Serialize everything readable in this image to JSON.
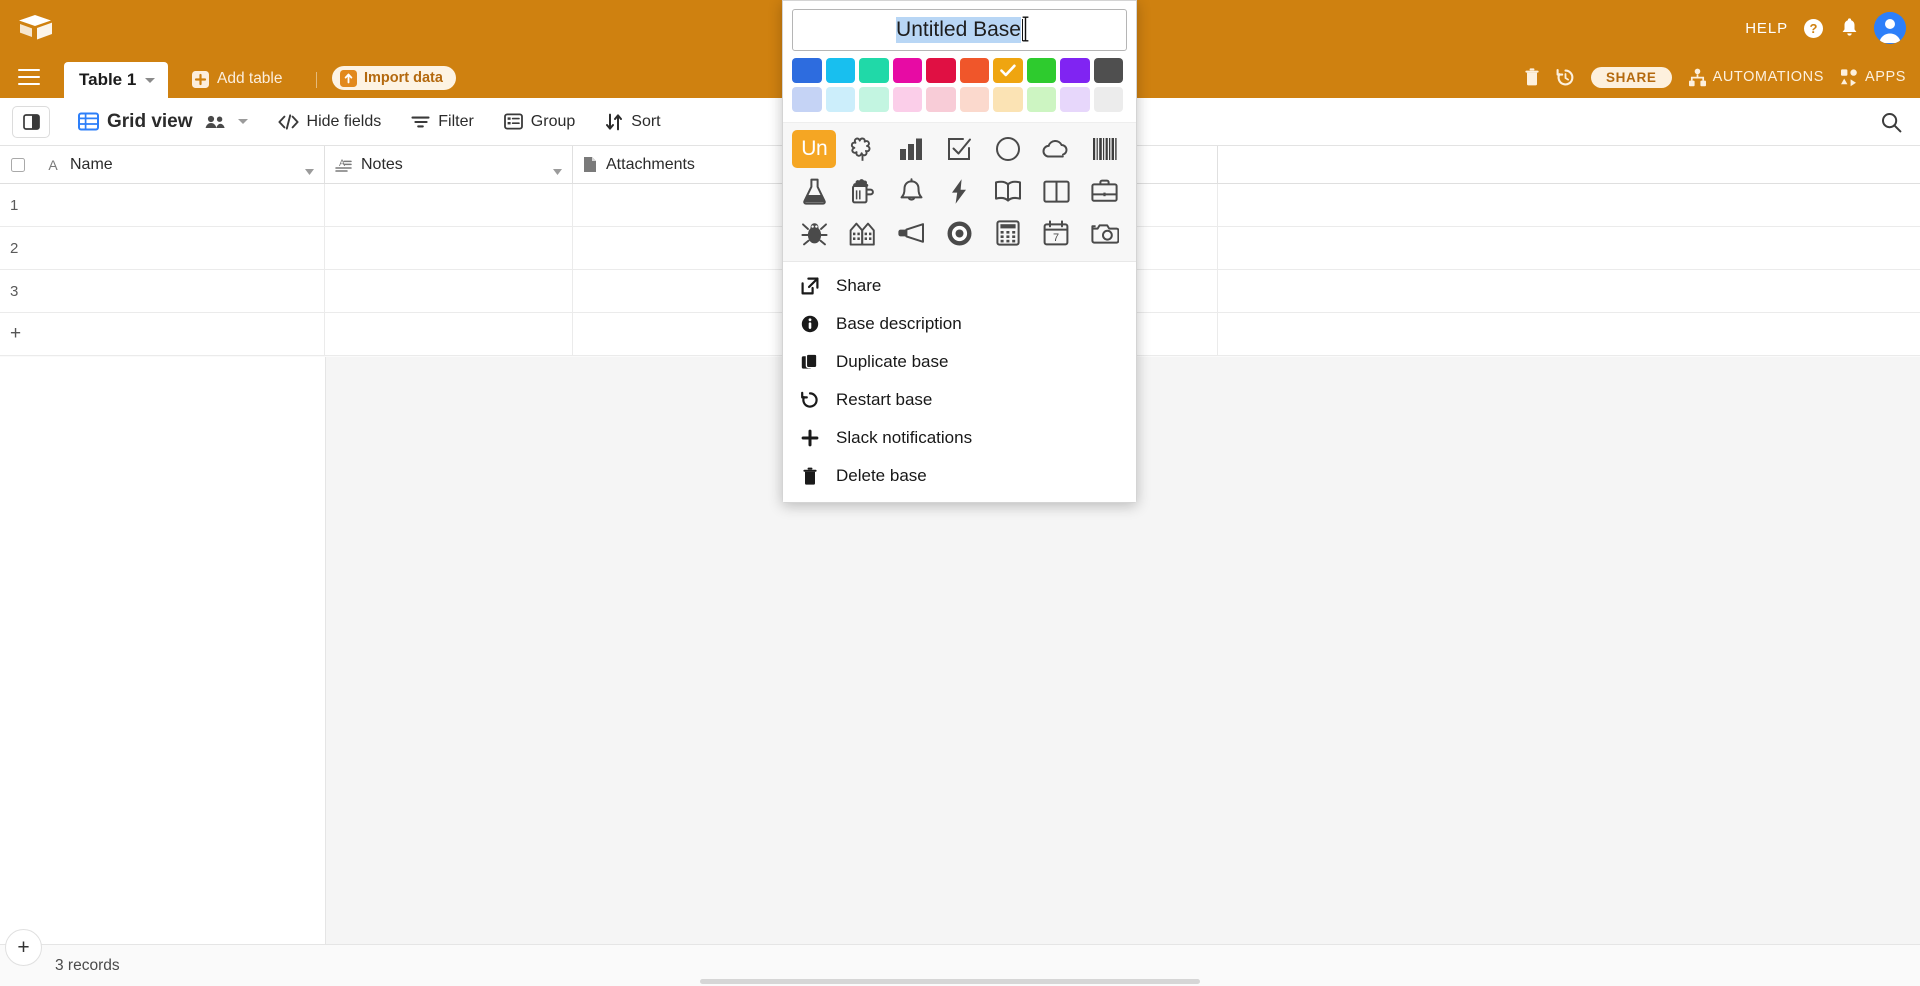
{
  "brand": {
    "logo_icon": "airtable-cube-logo",
    "header_bg": "#cf8110",
    "accent": "#2d7ff9"
  },
  "topbar": {
    "help_label": "HELP",
    "help_icon": "question-circle-icon",
    "notifications_icon": "bell-icon",
    "avatar_icon": "user-avatar-icon"
  },
  "tabbar": {
    "menu_icon": "hamburger-menu-icon",
    "active_tab": "Table 1",
    "tab_caret_icon": "chevron-down-icon",
    "add_table_label": "Add table",
    "add_table_icon": "plus-square-icon",
    "import_label": "Import data",
    "import_icon": "upload-arrow-icon",
    "tools": {
      "trash_icon": "trash-icon",
      "history_icon": "clock-history-icon",
      "share_label": "SHARE",
      "automations_label": "AUTOMATIONS",
      "automations_icon": "automations-node-icon",
      "apps_label": "APPS",
      "apps_icon": "apps-blocks-icon"
    }
  },
  "viewbar": {
    "sidebar_toggle_icon": "sidebar-panel-icon",
    "grid_view_label": "Grid view",
    "grid_view_icon": "grid-table-icon",
    "collaborators_icon": "people-group-icon",
    "view_caret_icon": "chevron-down-icon",
    "items": [
      {
        "label": "Hide fields",
        "icon": "hide-fields-icon"
      },
      {
        "label": "Filter",
        "icon": "filter-icon"
      },
      {
        "label": "Group",
        "icon": "group-icon"
      },
      {
        "label": "Sort",
        "icon": "sort-arrows-icon"
      }
    ],
    "search_icon": "search-icon"
  },
  "grid": {
    "select_all_icon": "checkbox-icon",
    "columns": [
      {
        "name": "Name",
        "type_icon": "text-A-icon"
      },
      {
        "name": "Notes",
        "type_icon": "long-text-icon"
      },
      {
        "name": "Attachments",
        "type_icon": "attachment-file-icon"
      }
    ],
    "rows": [
      {
        "num": "1",
        "Name": "",
        "Notes": "",
        "Attachments": ""
      },
      {
        "num": "2",
        "Name": "",
        "Notes": "",
        "Attachments": ""
      },
      {
        "num": "3",
        "Name": "",
        "Notes": "",
        "Attachments": ""
      }
    ],
    "add_row_icon": "plus-icon"
  },
  "footer": {
    "add_record_icon": "plus-icon",
    "record_count": "3 records"
  },
  "popup": {
    "title_value": "Untitled Base",
    "title_selected": true,
    "cursor_icon": "text-ibeam-cursor",
    "colors_row1": [
      {
        "name": "blue",
        "hex": "#2d6cdf"
      },
      {
        "name": "cyan",
        "hex": "#18bfef"
      },
      {
        "name": "teal",
        "hex": "#20d9a8"
      },
      {
        "name": "magenta",
        "hex": "#e70ba4"
      },
      {
        "name": "crimson",
        "hex": "#e01043"
      },
      {
        "name": "orangered",
        "hex": "#f0562a"
      },
      {
        "name": "amber",
        "hex": "#efa510"
      },
      {
        "name": "green",
        "hex": "#2ecb2e"
      },
      {
        "name": "purple",
        "hex": "#8024f2"
      },
      {
        "name": "gray",
        "hex": "#4f4f4f"
      }
    ],
    "colors_row2": [
      {
        "name": "blue-light",
        "hex": "#c5d3f5"
      },
      {
        "name": "cyan-light",
        "hex": "#cceefb"
      },
      {
        "name": "teal-light",
        "hex": "#c3f5e1"
      },
      {
        "name": "magenta-light",
        "hex": "#fbcee9"
      },
      {
        "name": "crimson-light",
        "hex": "#f8ccd7"
      },
      {
        "name": "orangered-light",
        "hex": "#fbd9cd"
      },
      {
        "name": "amber-light",
        "hex": "#fbe3b4"
      },
      {
        "name": "green-light",
        "hex": "#cdf5c2"
      },
      {
        "name": "purple-light",
        "hex": "#e7d7fb"
      },
      {
        "name": "gray-light",
        "hex": "#ececec"
      }
    ],
    "selected_color": "amber",
    "selected_color_check_icon": "check-icon",
    "icons": [
      "Un",
      "asterisk-flower-icon",
      "bar-chart-icon",
      "checkbox-check-icon",
      "circle-icon",
      "cloud-icon",
      "barcode-icon",
      "flask-icon",
      "beer-mug-icon",
      "bell-icon",
      "lightning-bolt-icon",
      "open-book-icon",
      "book-closed-icon",
      "briefcase-icon",
      "bug-icon",
      "buildings-icon",
      "megaphone-icon",
      "disc-icon",
      "calculator-icon",
      "calendar-icon",
      "camera-icon"
    ],
    "selected_icon": "Un",
    "calendar_day": "7",
    "menu": [
      {
        "label": "Share",
        "icon": "share-external-icon"
      },
      {
        "label": "Base description",
        "icon": "info-circle-icon"
      },
      {
        "label": "Duplicate base",
        "icon": "duplicate-copy-icon"
      },
      {
        "label": "Restart base",
        "icon": "restart-undo-icon"
      },
      {
        "label": "Slack notifications",
        "icon": "slack-icon"
      },
      {
        "label": "Delete base",
        "icon": "trash-icon"
      }
    ]
  }
}
